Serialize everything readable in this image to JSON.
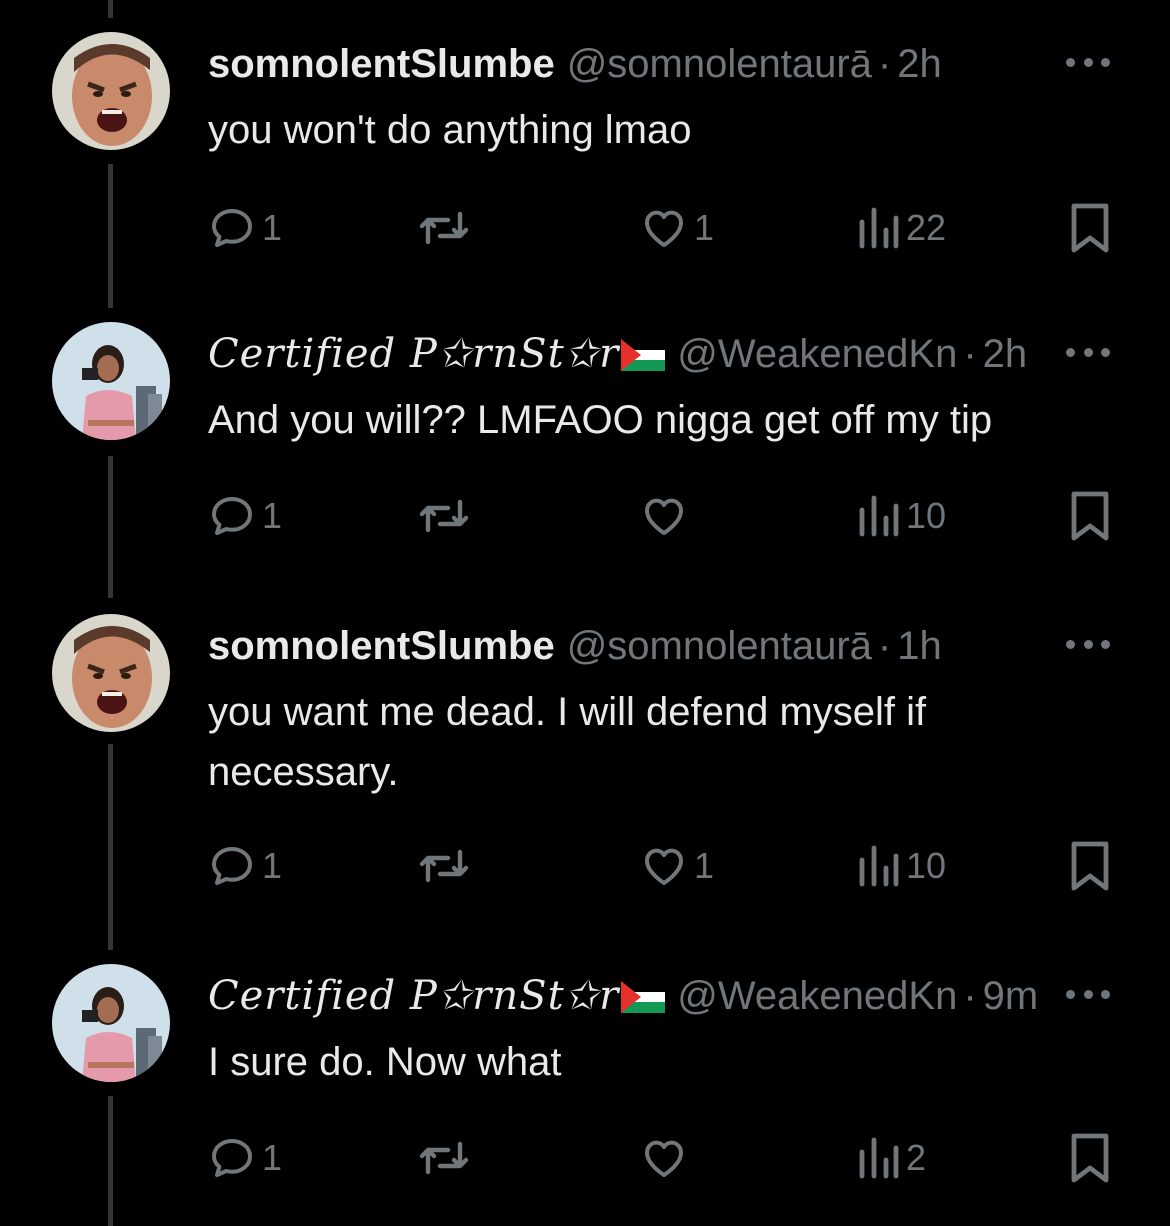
{
  "tweets": [
    {
      "name": "somnolentSlumbe",
      "handle": "@somnolentaurā",
      "time": "2h",
      "text": "you won't do anything lmao",
      "reply_count": "1",
      "like_count": "1",
      "view_count": "22"
    },
    {
      "name": "Certified P✩rnSt✩r",
      "handle": "@WeakenedKn",
      "time": "2h",
      "text": "And you will?? LMFAOO nigga get off my tip",
      "reply_count": "1",
      "like_count": "",
      "view_count": "10"
    },
    {
      "name": "somnolentSlumbe",
      "handle": "@somnolentaurā",
      "time": "1h",
      "text": "you want me dead. I will defend myself if necessary.",
      "reply_count": "1",
      "like_count": "1",
      "view_count": "10"
    },
    {
      "name": "Certified P✩rnSt✩r",
      "handle": "@WeakenedKn",
      "time": "9m",
      "text": "I sure do. Now what",
      "reply_count": "1",
      "like_count": "",
      "view_count": "2"
    }
  ],
  "icons": {
    "reply": "reply-icon",
    "retweet": "retweet-icon",
    "like": "heart-icon",
    "views": "analytics-icon",
    "bookmark": "bookmark-icon",
    "more": "more-icon",
    "flag": "palestine-flag-icon"
  },
  "colors": {
    "background": "#000000",
    "text": "#e7e9ea",
    "muted": "#71767b",
    "thread_line": "#333639"
  }
}
